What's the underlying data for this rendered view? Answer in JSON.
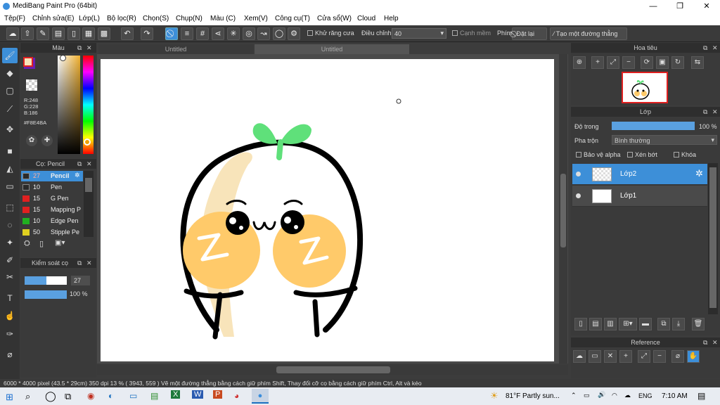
{
  "window": {
    "title": "MediBang Paint Pro (64bit)",
    "min": "—",
    "max": "❐",
    "close": "✕"
  },
  "menu": [
    "Tệp(F)",
    "Chỉnh sửa(E)",
    "Lớp(L)",
    "Bộ lọc(R)",
    "Chọn(S)",
    "Chụp(N)",
    "Màu (C)",
    "Xem(V)",
    "Công cụ(T)",
    "Cửa sổ(W)",
    "Cloud",
    "Help"
  ],
  "toolbar": {
    "antialias": "Khử răng cưa",
    "correction_label": "Điều chỉnh",
    "correction_value": "40",
    "sharp": "Cạnh mềm",
    "key_label": "Phím",
    "reset": "Đặt lại",
    "straight_line": "Tạo một đường thẳng"
  },
  "tabs": {
    "tab1": "Untitled",
    "tab2": "Untitled"
  },
  "color_panel": {
    "title": "Màu",
    "r": "R:248",
    "g": "G:228",
    "b": "B:186",
    "hex": "#F8E4BA",
    "fg": "#F8E4BA",
    "bg": "#6a1fb0"
  },
  "brush_panel": {
    "title": "Cọ: Pencil",
    "brushes": [
      {
        "size": "27",
        "name": "Pencil",
        "color": "#2a2a2a"
      },
      {
        "size": "10",
        "name": "Pen",
        "color": "#2a2a2a"
      },
      {
        "size": "15",
        "name": "G Pen",
        "color": "#e02020"
      },
      {
        "size": "15",
        "name": "Mapping P",
        "color": "#e02020"
      },
      {
        "size": "10",
        "name": "Edge Pen",
        "color": "#20b020"
      },
      {
        "size": "50",
        "name": "Stipple Pe",
        "color": "#e0d020"
      }
    ]
  },
  "brush_control": {
    "title": "Kiểm soát cọ",
    "size": "27",
    "opacity": "100 %"
  },
  "navigator": {
    "title": "Hoa tiêu"
  },
  "layers": {
    "title": "Lớp",
    "opacity_label": "Độ trong",
    "opacity_value": "100 %",
    "blend_label": "Pha trộn",
    "blend_value": "Bình thường",
    "protect_alpha": "Bảo vệ alpha",
    "clipping": "Xén bớt",
    "lock": "Khóa",
    "items": [
      {
        "name": "Lớp2"
      },
      {
        "name": "Lớp1"
      }
    ]
  },
  "reference": {
    "title": "Reference"
  },
  "status": {
    "size": "6000 * 4000 pixel   (43.5 * 29cm)   350 dpi   13 %   ( 3943, 559 )   Vẽ một đường thẳng bằng cách giữ phím Shift, Thay đổi cỡ cọ bằng cách giữ phím Ctrl, Alt và kéo"
  },
  "taskbar": {
    "weather": "81°F  Partly sun...",
    "lang": "ENG",
    "time": "7:10 AM"
  }
}
